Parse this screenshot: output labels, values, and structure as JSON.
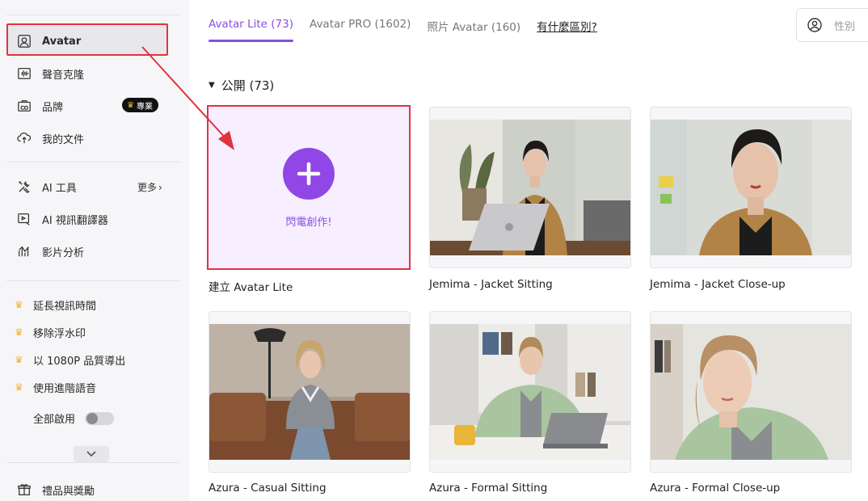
{
  "sidebar": {
    "items": [
      {
        "label": "Avatar",
        "icon": "user-portrait-icon"
      },
      {
        "label": "聲音克隆",
        "icon": "waveform-icon"
      },
      {
        "label": "品牌",
        "icon": "brand-co-icon"
      },
      {
        "label": "我的文件",
        "icon": "cloud-upload-icon"
      }
    ],
    "pro_badge": "專業",
    "tools": [
      {
        "label": "AI 工具",
        "icon": "tools-icon"
      },
      {
        "label": "AI 視訊翻譯器",
        "icon": "video-translate-icon"
      },
      {
        "label": "影片分析",
        "icon": "analytics-icon"
      }
    ],
    "more_label": "更多",
    "perks": [
      "延長視訊時間",
      "移除浮水印",
      "以 1080P 品質導出",
      "使用進階語音"
    ],
    "enable_all_label": "全部啟用",
    "enable_all_on": false,
    "gift_label": "禮品與獎勵"
  },
  "tabs": [
    {
      "label": "Avatar Lite (73)",
      "active": true
    },
    {
      "label": "Avatar PRO (1602)",
      "active": false
    },
    {
      "label": "照片 Avatar (160)",
      "active": false
    },
    {
      "label": "有什麼區別?",
      "active": false,
      "link": true
    }
  ],
  "gender_filter": {
    "placeholder": "性別"
  },
  "section": {
    "title": "公開 (73)"
  },
  "create": {
    "button_text": "閃電創作!",
    "label": "建立 Avatar Lite"
  },
  "avatars": [
    {
      "name": "Jemima - Jacket Sitting"
    },
    {
      "name": "Jemima - Jacket Close-up"
    },
    {
      "name": "Azura - Casual Sitting"
    },
    {
      "name": "Azura - Formal Sitting"
    },
    {
      "name": "Azura - Formal Close-up"
    }
  ],
  "colors": {
    "accent": "#8a4fe0",
    "highlight": "#e0333f",
    "plus_bg": "#9047e6"
  }
}
